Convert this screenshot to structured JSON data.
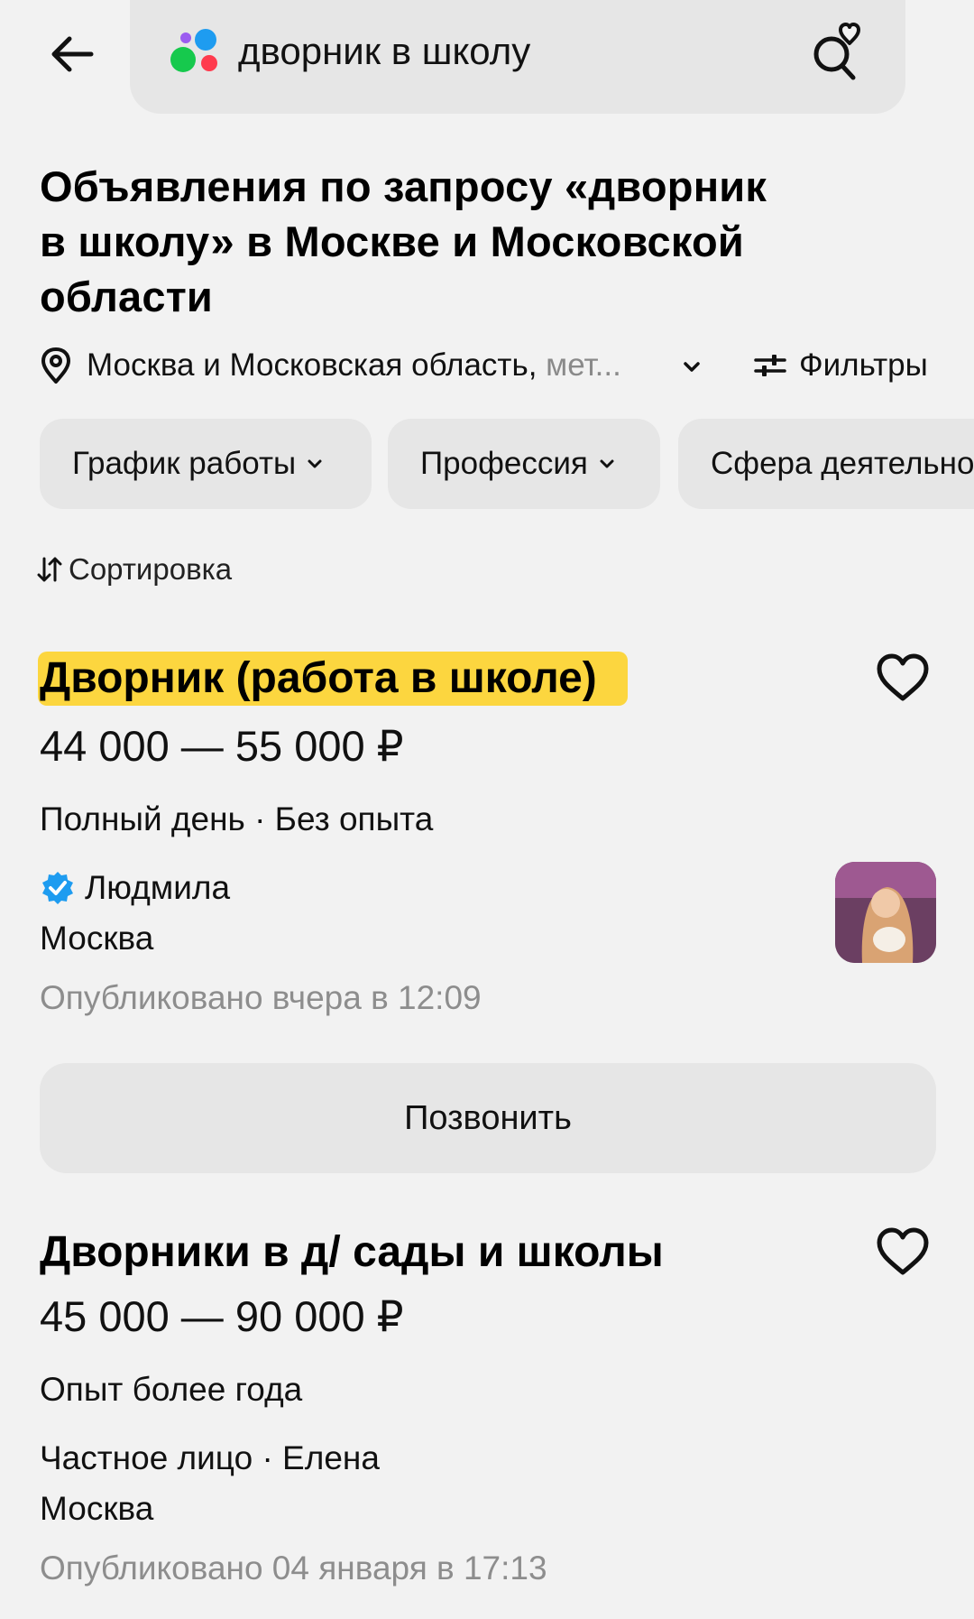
{
  "search": {
    "query": "дворник в школу"
  },
  "heading": {
    "line1": "Объявления по запросу «дворник",
    "line2": "в школу» в Москве и Московской",
    "line3": "области"
  },
  "location": {
    "main": "Москва и Московская область,",
    "suffix": " мет..."
  },
  "filters": {
    "label": "Фильтры"
  },
  "chips": [
    {
      "label": "График работы"
    },
    {
      "label": "Профессия"
    },
    {
      "label": "Сфера деятельно"
    }
  ],
  "sort": {
    "label": "Сортировка"
  },
  "listings": [
    {
      "title": "Дворник (работа в школе)",
      "price": "44 000 — 55 000 ₽",
      "conditions": "Полный день · Без опыта",
      "author": "Людмила",
      "city": "Москва",
      "published": "Опубликовано вчера в 12:09",
      "call_label": "Позвонить"
    },
    {
      "title": "Дворники в д/ сады и школы",
      "price": "45 000 — 90 000 ₽",
      "conditions": "Опыт более года",
      "author": "Частное лицо · Елена",
      "city": "Москва",
      "published": "Опубликовано 04 января в 17:13"
    }
  ],
  "colors": {
    "background": "#f2f2f2",
    "chip": "#e6e6e6",
    "highlight": "#fcd63f",
    "verified": "#1e9cf0",
    "muted_text": "#8d8d8d"
  }
}
